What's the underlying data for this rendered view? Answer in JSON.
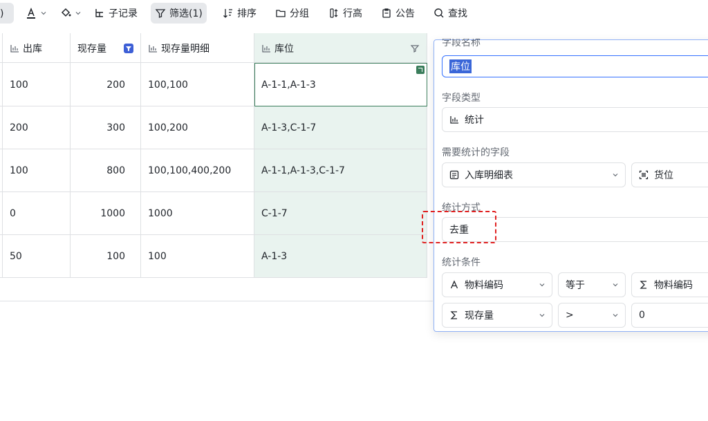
{
  "toolbar": {
    "left_fragment": "规)",
    "subrecord_label": "子记录",
    "filter_label": "筛选(1)",
    "sort_label": "排序",
    "group_label": "分组",
    "rowheight_label": "行高",
    "notice_label": "公告",
    "search_label": "查找"
  },
  "table": {
    "headers": [
      "出库",
      "现存量",
      "现存量明细",
      "库位"
    ],
    "rows": [
      [
        "100",
        "200",
        "100,100",
        "A-1-1,A-1-3"
      ],
      [
        "200",
        "300",
        "100,200",
        "A-1-3,C-1-7"
      ],
      [
        "100",
        "800",
        "100,100,400,200",
        "A-1-1,A-1-3,C-1-7"
      ],
      [
        "0",
        "1000",
        "1000",
        "C-1-7"
      ],
      [
        "50",
        "100",
        "100",
        "A-1-3"
      ]
    ]
  },
  "panel": {
    "name_label": "字段名称",
    "name_value": "库位",
    "type_label": "字段类型",
    "type_value": "统计",
    "stat_field_label": "需要统计的字段",
    "stat_table": "入库明细表",
    "stat_field": "货位",
    "method_label": "统计方式",
    "method_value": "去重",
    "cond_label": "统计条件",
    "conditions": [
      {
        "field": "物料编码",
        "op": "等于",
        "value": "物料编码"
      },
      {
        "field": "现存量",
        "op": ">",
        "value": "0"
      }
    ]
  },
  "colors": {
    "accent": "#3370ff",
    "selected_col": "#e9f3ef",
    "highlight": "#e02020"
  }
}
